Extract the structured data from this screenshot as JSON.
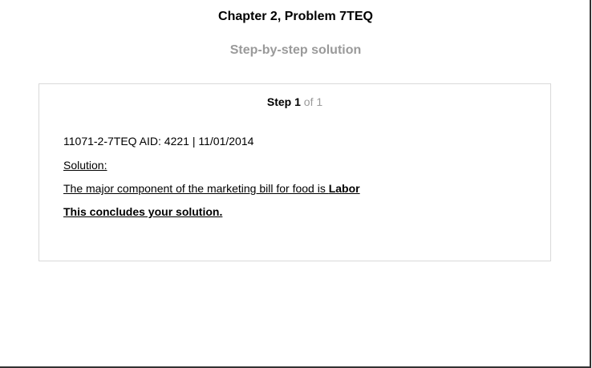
{
  "header": {
    "title": "Chapter 2, Problem 7TEQ",
    "subtitle": "Step-by-step solution"
  },
  "step": {
    "label": "Step",
    "number": "1",
    "of_text": "of 1"
  },
  "content": {
    "meta_line": "11071-2-7TEQ AID: 4221 | 11/01/2014",
    "solution_label": "Solution:",
    "answer_prefix": "The major component of the marketing bill for food is ",
    "answer_value": "Labor",
    "conclusion": "This concludes your solution."
  }
}
